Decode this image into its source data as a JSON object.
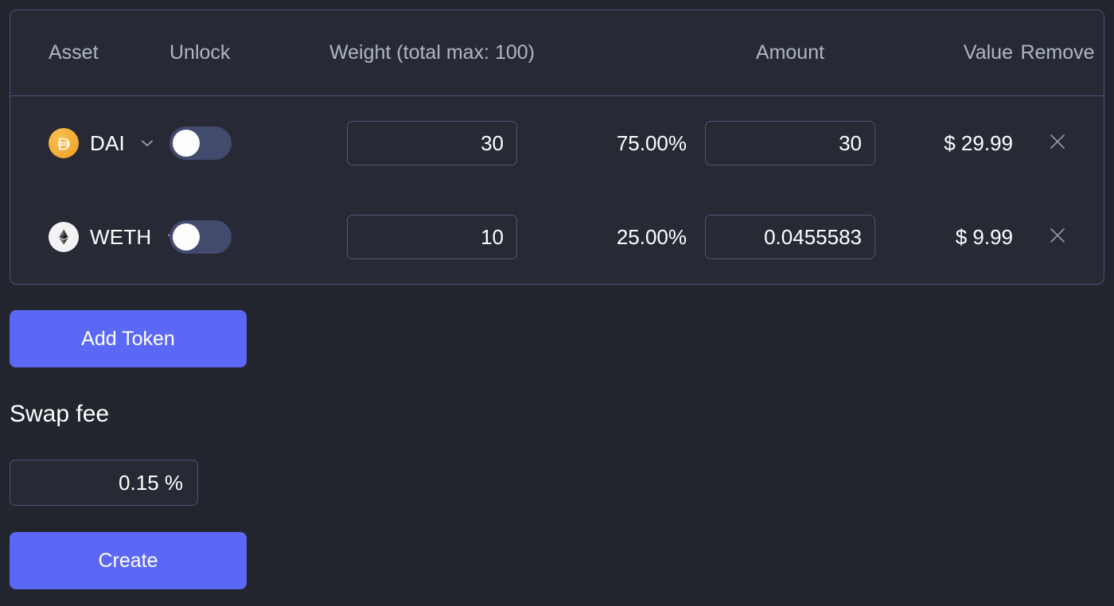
{
  "table": {
    "columns": {
      "asset": "Asset",
      "unlock": "Unlock",
      "weight": "Weight (total max: 100)",
      "amount": "Amount",
      "value": "Value",
      "remove": "Remove"
    },
    "rows": [
      {
        "symbol": "DAI",
        "logo_icon": "dai-token-icon",
        "logo_color": "#f5ac37",
        "unlocked": false,
        "weight": "30",
        "percent": "75.00%",
        "amount": "30",
        "value": "$ 29.99",
        "remove_icon": "close-icon"
      },
      {
        "symbol": "WETH",
        "logo_icon": "weth-token-icon",
        "logo_color": "#f3f3f5",
        "unlocked": false,
        "weight": "10",
        "percent": "25.00%",
        "amount": "0.0455583",
        "value": "$ 9.99",
        "remove_icon": "close-icon"
      }
    ]
  },
  "controls": {
    "add_token_label": "Add Token",
    "swap_fee_label": "Swap fee",
    "swap_fee_value": "0.15 %",
    "create_label": "Create"
  },
  "colors": {
    "page_bg": "#22242e",
    "card_bg": "#272a35",
    "border": "#4d5378",
    "accent": "#5b68f5",
    "header_text": "#aeb6c4",
    "toggle_track": "#424a6e"
  },
  "icons": {
    "chevron": "chevron-down-icon",
    "close": "close-icon"
  }
}
